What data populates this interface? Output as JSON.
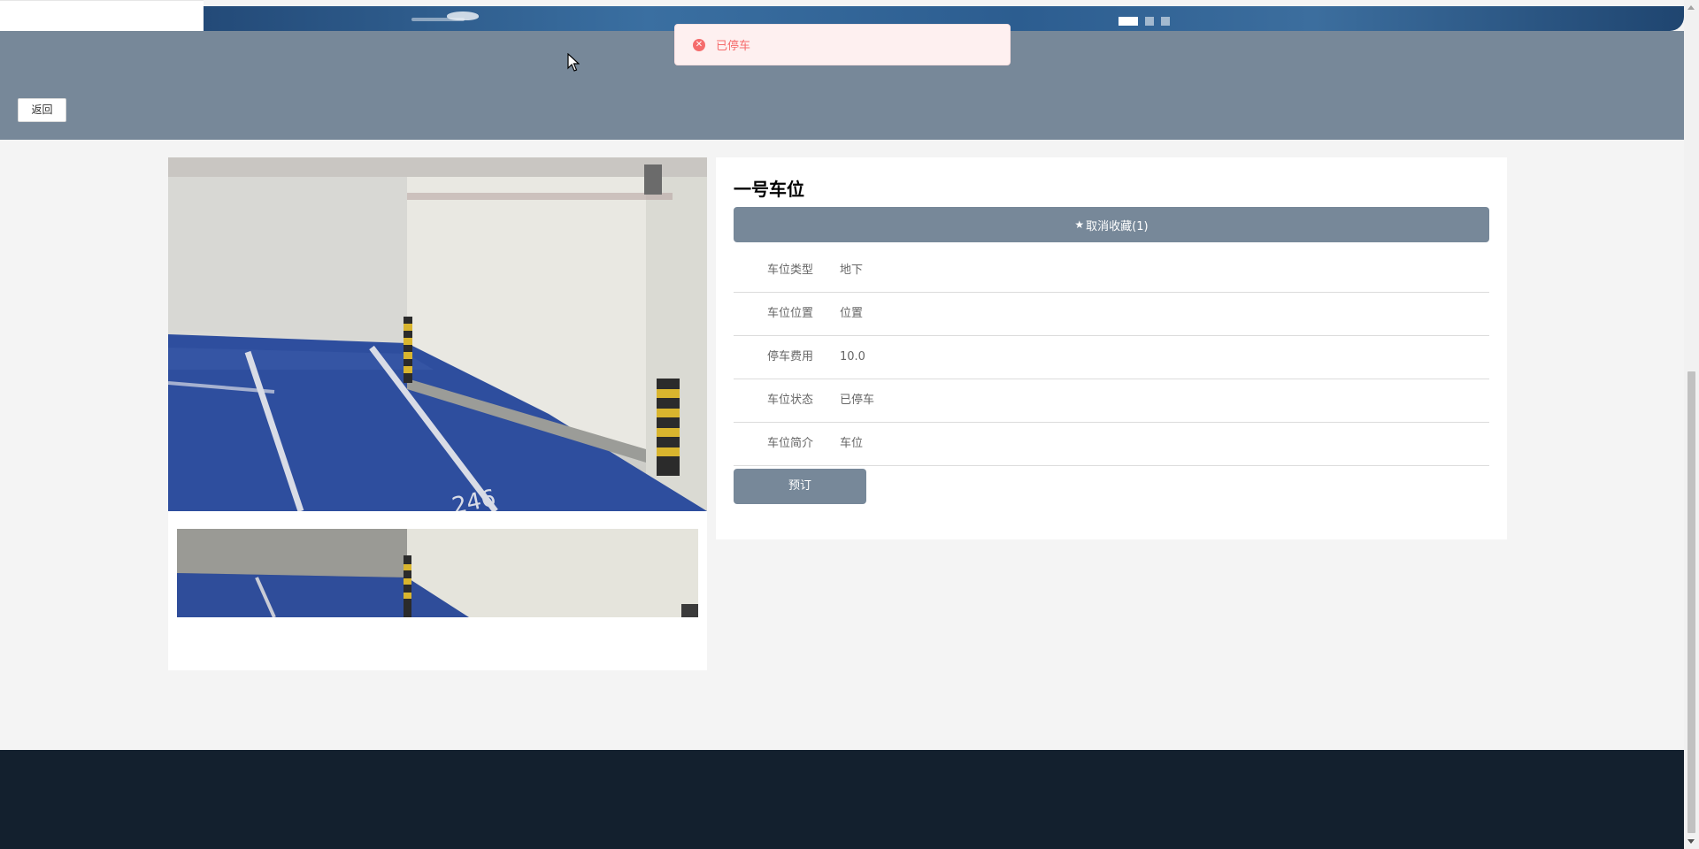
{
  "toast": {
    "message": "已停车",
    "icon": "error-circle-icon",
    "color": "#f56c6c"
  },
  "header": {
    "back_label": "返回",
    "band_color": "#778899"
  },
  "detail": {
    "title": "一号车位",
    "favorite_label": "取消收藏(1)",
    "favorite_icon": "star-icon",
    "fields": [
      {
        "label": "车位类型",
        "value": "地下"
      },
      {
        "label": "车位位置",
        "value": "位置"
      },
      {
        "label": "停车费用",
        "value": "10.0"
      },
      {
        "label": "车位状态",
        "value": "已停车"
      },
      {
        "label": "车位简介",
        "value": "车位"
      }
    ],
    "book_label": "预订"
  },
  "photo": {
    "stall_number": "246"
  },
  "colors": {
    "accent": "#778899",
    "footer": "#13202e",
    "page_bg": "#f4f4f4"
  }
}
